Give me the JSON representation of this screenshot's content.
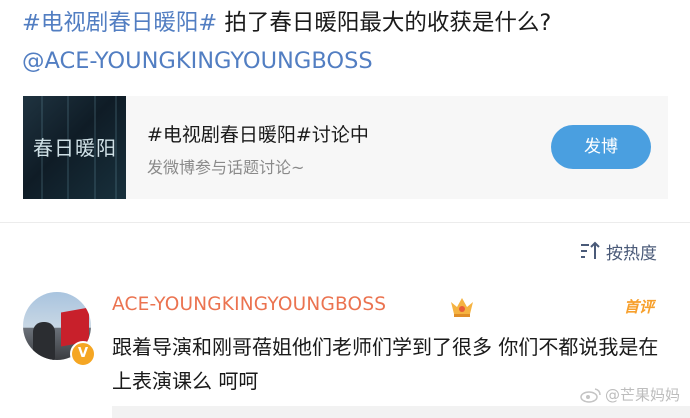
{
  "post": {
    "topic": "#电视剧春日暖阳#",
    "question": "拍了春日暖阳最大的收获是什么?",
    "mention": "@ACE-YOUNGKINGYOUNGBOSS"
  },
  "topic_card": {
    "image_text": "春日暖阳",
    "title": "#电视剧春日暖阳#讨论中",
    "subtitle": "发微博参与话题讨论~",
    "button_label": "发博"
  },
  "sort": {
    "label": "按热度",
    "icon": "sort-icon"
  },
  "comment": {
    "username": "ACE-YOUNGKINGYOUNGBOSS",
    "verified_badge": "V",
    "tag": "首评",
    "text": "跟着导演和刚哥蓓姐他们老师们学到了很多 你们不都说我是在上表演课么 呵呵",
    "colors": {
      "username": "#eb7350",
      "tag": "#f7a02c"
    }
  },
  "watermark": "@芒果妈妈",
  "colors": {
    "link": "#527ec2",
    "button": "#4a9fe0"
  }
}
